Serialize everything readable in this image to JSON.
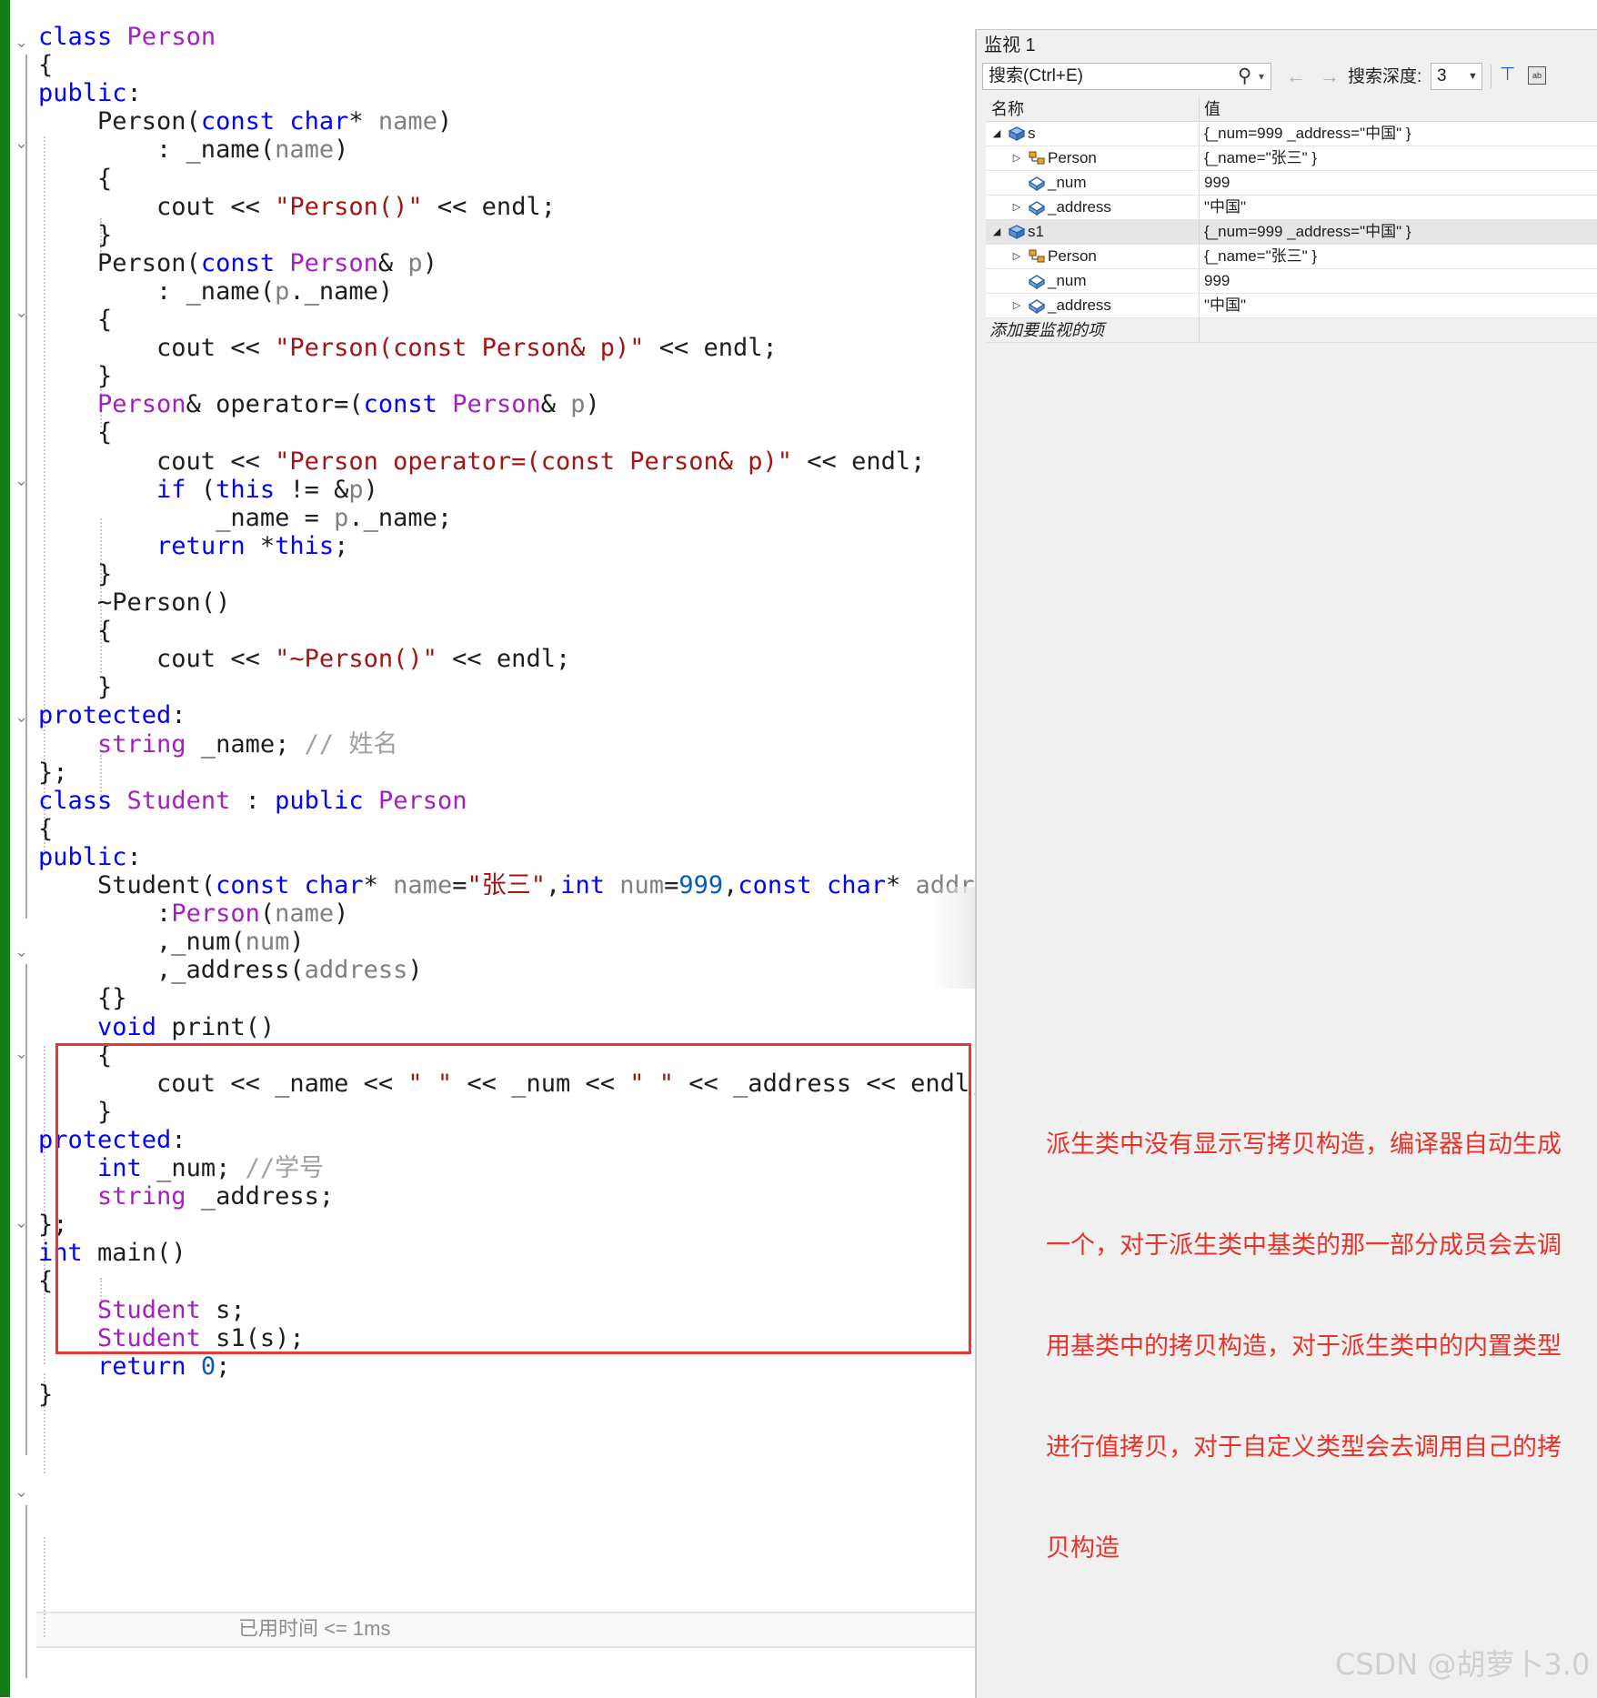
{
  "editor": {
    "lines": [
      [
        {
          "t": "class",
          "c": "kw"
        },
        {
          "t": " "
        },
        {
          "t": "Person",
          "c": "ty"
        }
      ],
      [
        {
          "t": "{"
        }
      ],
      [
        {
          "t": "public",
          "c": "kw"
        },
        {
          "t": ":"
        }
      ],
      [
        {
          "t": "    Person("
        },
        {
          "t": "const",
          "c": "kw"
        },
        {
          "t": " "
        },
        {
          "t": "char",
          "c": "kw"
        },
        {
          "t": "* "
        },
        {
          "t": "name",
          "c": "pm"
        },
        {
          "t": ")"
        }
      ],
      [
        {
          "t": "        : _name("
        },
        {
          "t": "name",
          "c": "pm"
        },
        {
          "t": ")"
        }
      ],
      [
        {
          "t": "    {"
        }
      ],
      [
        {
          "t": "        cout << "
        },
        {
          "t": "\"Person()\"",
          "c": "str"
        },
        {
          "t": " << endl;"
        }
      ],
      [
        {
          "t": "    }"
        }
      ],
      [
        {
          "t": "    Person("
        },
        {
          "t": "const",
          "c": "kw"
        },
        {
          "t": " "
        },
        {
          "t": "Person",
          "c": "ty"
        },
        {
          "t": "& "
        },
        {
          "t": "p",
          "c": "pm"
        },
        {
          "t": ")"
        }
      ],
      [
        {
          "t": "        : _name("
        },
        {
          "t": "p",
          "c": "pm"
        },
        {
          "t": "._name)"
        }
      ],
      [
        {
          "t": "    {"
        }
      ],
      [
        {
          "t": "        cout << "
        },
        {
          "t": "\"Person(const Person& p)\"",
          "c": "str"
        },
        {
          "t": " << endl;"
        }
      ],
      [
        {
          "t": "    }"
        }
      ],
      [
        {
          "t": "    "
        },
        {
          "t": "Person",
          "c": "ty"
        },
        {
          "t": "& operator=("
        },
        {
          "t": "const",
          "c": "kw"
        },
        {
          "t": " "
        },
        {
          "t": "Person",
          "c": "ty"
        },
        {
          "t": "& "
        },
        {
          "t": "p",
          "c": "pm"
        },
        {
          "t": ")"
        }
      ],
      [
        {
          "t": "    {"
        }
      ],
      [
        {
          "t": "        cout << "
        },
        {
          "t": "\"Person operator=(const Person& p)\"",
          "c": "str"
        },
        {
          "t": " << endl;"
        }
      ],
      [
        {
          "t": "        "
        },
        {
          "t": "if",
          "c": "kw"
        },
        {
          "t": " ("
        },
        {
          "t": "this",
          "c": "kw"
        },
        {
          "t": " != &"
        },
        {
          "t": "p",
          "c": "pm"
        },
        {
          "t": ")"
        }
      ],
      [
        {
          "t": "            _name = "
        },
        {
          "t": "p",
          "c": "pm"
        },
        {
          "t": "._name;"
        }
      ],
      [
        {
          "t": "        "
        },
        {
          "t": "return",
          "c": "kw"
        },
        {
          "t": " *"
        },
        {
          "t": "this",
          "c": "kw"
        },
        {
          "t": ";"
        }
      ],
      [
        {
          "t": "    }"
        }
      ],
      [
        {
          "t": "    ~Person()"
        }
      ],
      [
        {
          "t": "    {"
        }
      ],
      [
        {
          "t": "        cout << "
        },
        {
          "t": "\"~Person()\"",
          "c": "str"
        },
        {
          "t": " << endl;"
        }
      ],
      [
        {
          "t": "    }"
        }
      ],
      [
        {
          "t": "protected",
          "c": "kw"
        },
        {
          "t": ":"
        }
      ],
      [
        {
          "t": "    "
        },
        {
          "t": "string",
          "c": "ty"
        },
        {
          "t": " _name; "
        },
        {
          "t": "// 姓名",
          "c": "cm"
        }
      ],
      [
        {
          "t": "};"
        }
      ],
      [
        {
          "t": "class",
          "c": "kw"
        },
        {
          "t": " "
        },
        {
          "t": "Student",
          "c": "ty"
        },
        {
          "t": " : "
        },
        {
          "t": "public",
          "c": "kw"
        },
        {
          "t": " "
        },
        {
          "t": "Person",
          "c": "ty"
        }
      ],
      [
        {
          "t": "{"
        }
      ],
      [
        {
          "t": "public",
          "c": "kw"
        },
        {
          "t": ":"
        }
      ],
      [
        {
          "t": "    Student("
        },
        {
          "t": "const",
          "c": "kw"
        },
        {
          "t": " "
        },
        {
          "t": "char",
          "c": "kw"
        },
        {
          "t": "* "
        },
        {
          "t": "name",
          "c": "pm"
        },
        {
          "t": "="
        },
        {
          "t": "\"张三\"",
          "c": "str"
        },
        {
          "t": ","
        },
        {
          "t": "int",
          "c": "kw"
        },
        {
          "t": " "
        },
        {
          "t": "num",
          "c": "pm"
        },
        {
          "t": "="
        },
        {
          "t": "999",
          "c": "num"
        },
        {
          "t": ","
        },
        {
          "t": "const",
          "c": "kw"
        },
        {
          "t": " "
        },
        {
          "t": "char",
          "c": "kw"
        },
        {
          "t": "* "
        },
        {
          "t": "address",
          "c": "pm"
        },
        {
          "t": "="
        }
      ],
      [
        {
          "t": "        :"
        },
        {
          "t": "Person",
          "c": "ty"
        },
        {
          "t": "("
        },
        {
          "t": "name",
          "c": "pm"
        },
        {
          "t": ")"
        }
      ],
      [
        {
          "t": "        ,_num("
        },
        {
          "t": "num",
          "c": "pm"
        },
        {
          "t": ")"
        }
      ],
      [
        {
          "t": "        ,_address("
        },
        {
          "t": "address",
          "c": "pm"
        },
        {
          "t": ")"
        }
      ],
      [
        {
          "t": "    {}"
        }
      ],
      [
        {
          "t": "    "
        },
        {
          "t": "void",
          "c": "kw"
        },
        {
          "t": " print()"
        }
      ],
      [
        {
          "t": "    {"
        }
      ],
      [
        {
          "t": "        cout << _name << "
        },
        {
          "t": "\" \"",
          "c": "str"
        },
        {
          "t": " << _num << "
        },
        {
          "t": "\" \"",
          "c": "str"
        },
        {
          "t": " << _address << endl;"
        }
      ],
      [
        {
          "t": "    }"
        }
      ],
      [
        {
          "t": "protected",
          "c": "kw"
        },
        {
          "t": ":"
        }
      ],
      [
        {
          "t": "    "
        },
        {
          "t": "int",
          "c": "kw"
        },
        {
          "t": " _num; "
        },
        {
          "t": "//学号",
          "c": "cm"
        }
      ],
      [
        {
          "t": "    "
        },
        {
          "t": "string",
          "c": "ty"
        },
        {
          "t": " _address;"
        }
      ],
      [
        {
          "t": "};"
        }
      ],
      [
        {
          "t": "int",
          "c": "kw"
        },
        {
          "t": " main()"
        }
      ],
      [
        {
          "t": "{"
        }
      ],
      [
        {
          "t": "    "
        },
        {
          "t": "Student",
          "c": "ty"
        },
        {
          "t": " s;"
        }
      ],
      [
        {
          "t": "    "
        },
        {
          "t": "Student",
          "c": "ty"
        },
        {
          "t": " s1(s);"
        }
      ],
      [
        {
          "t": "    "
        },
        {
          "t": "return",
          "c": "kw"
        },
        {
          "t": " "
        },
        {
          "t": "0",
          "c": "num"
        },
        {
          "t": ";"
        }
      ],
      [
        {
          "t": "}"
        }
      ]
    ],
    "elapsed_hint": "已用时间 <= 1ms",
    "colors": {
      "keyword": "#0000ff",
      "type": "#a31fc2",
      "string": "#a31515",
      "comment": "#a0a0a0",
      "param": "#808080",
      "number": "#0a58b8",
      "change_bar": "#137c13"
    }
  },
  "watch": {
    "title": "监视 1",
    "search_placeholder": "搜索(Ctrl+E)",
    "search_icon": "magnifier-icon",
    "depth_label": "搜索深度:",
    "depth_value": "3",
    "col_name": "名称",
    "col_value": "值",
    "rows": [
      {
        "level": 0,
        "expander": "◢",
        "icon": "object-icon",
        "name": "s",
        "value": "{_num=999 _address=\"中国\" }",
        "selected": false
      },
      {
        "level": 1,
        "expander": "▷",
        "icon": "base-class-icon",
        "name": "Person",
        "value": "{_name=\"张三\" }",
        "selected": false
      },
      {
        "level": 1,
        "expander": "",
        "icon": "field-icon",
        "name": "_num",
        "value": "999",
        "selected": false
      },
      {
        "level": 1,
        "expander": "▷",
        "icon": "field-icon",
        "name": "_address",
        "value": "\"中国\"",
        "selected": false
      },
      {
        "level": 0,
        "expander": "◢",
        "icon": "object-icon",
        "name": "s1",
        "value": "{_num=999 _address=\"中国\" }",
        "selected": true
      },
      {
        "level": 1,
        "expander": "▷",
        "icon": "base-class-icon",
        "name": "Person",
        "value": "{_name=\"张三\" }",
        "selected": false
      },
      {
        "level": 1,
        "expander": "",
        "icon": "field-icon",
        "name": "_num",
        "value": "999",
        "selected": false
      },
      {
        "level": 1,
        "expander": "▷",
        "icon": "field-icon",
        "name": "_address",
        "value": "\"中国\"",
        "selected": false
      }
    ],
    "add_item": "添加要监视的项"
  },
  "annotation": {
    "lines": [
      "派生类中没有显示写拷贝构造，编译器自动生成",
      "一个，对于派生类中基类的那一部分成员会去调",
      "用基类中的拷贝构造，对于派生类中的内置类型",
      "进行值拷贝，对于自定义类型会去调用自己的拷",
      "贝构造"
    ],
    "color": "#e8332a"
  },
  "watermark": "CSDN @胡萝卜3.0"
}
